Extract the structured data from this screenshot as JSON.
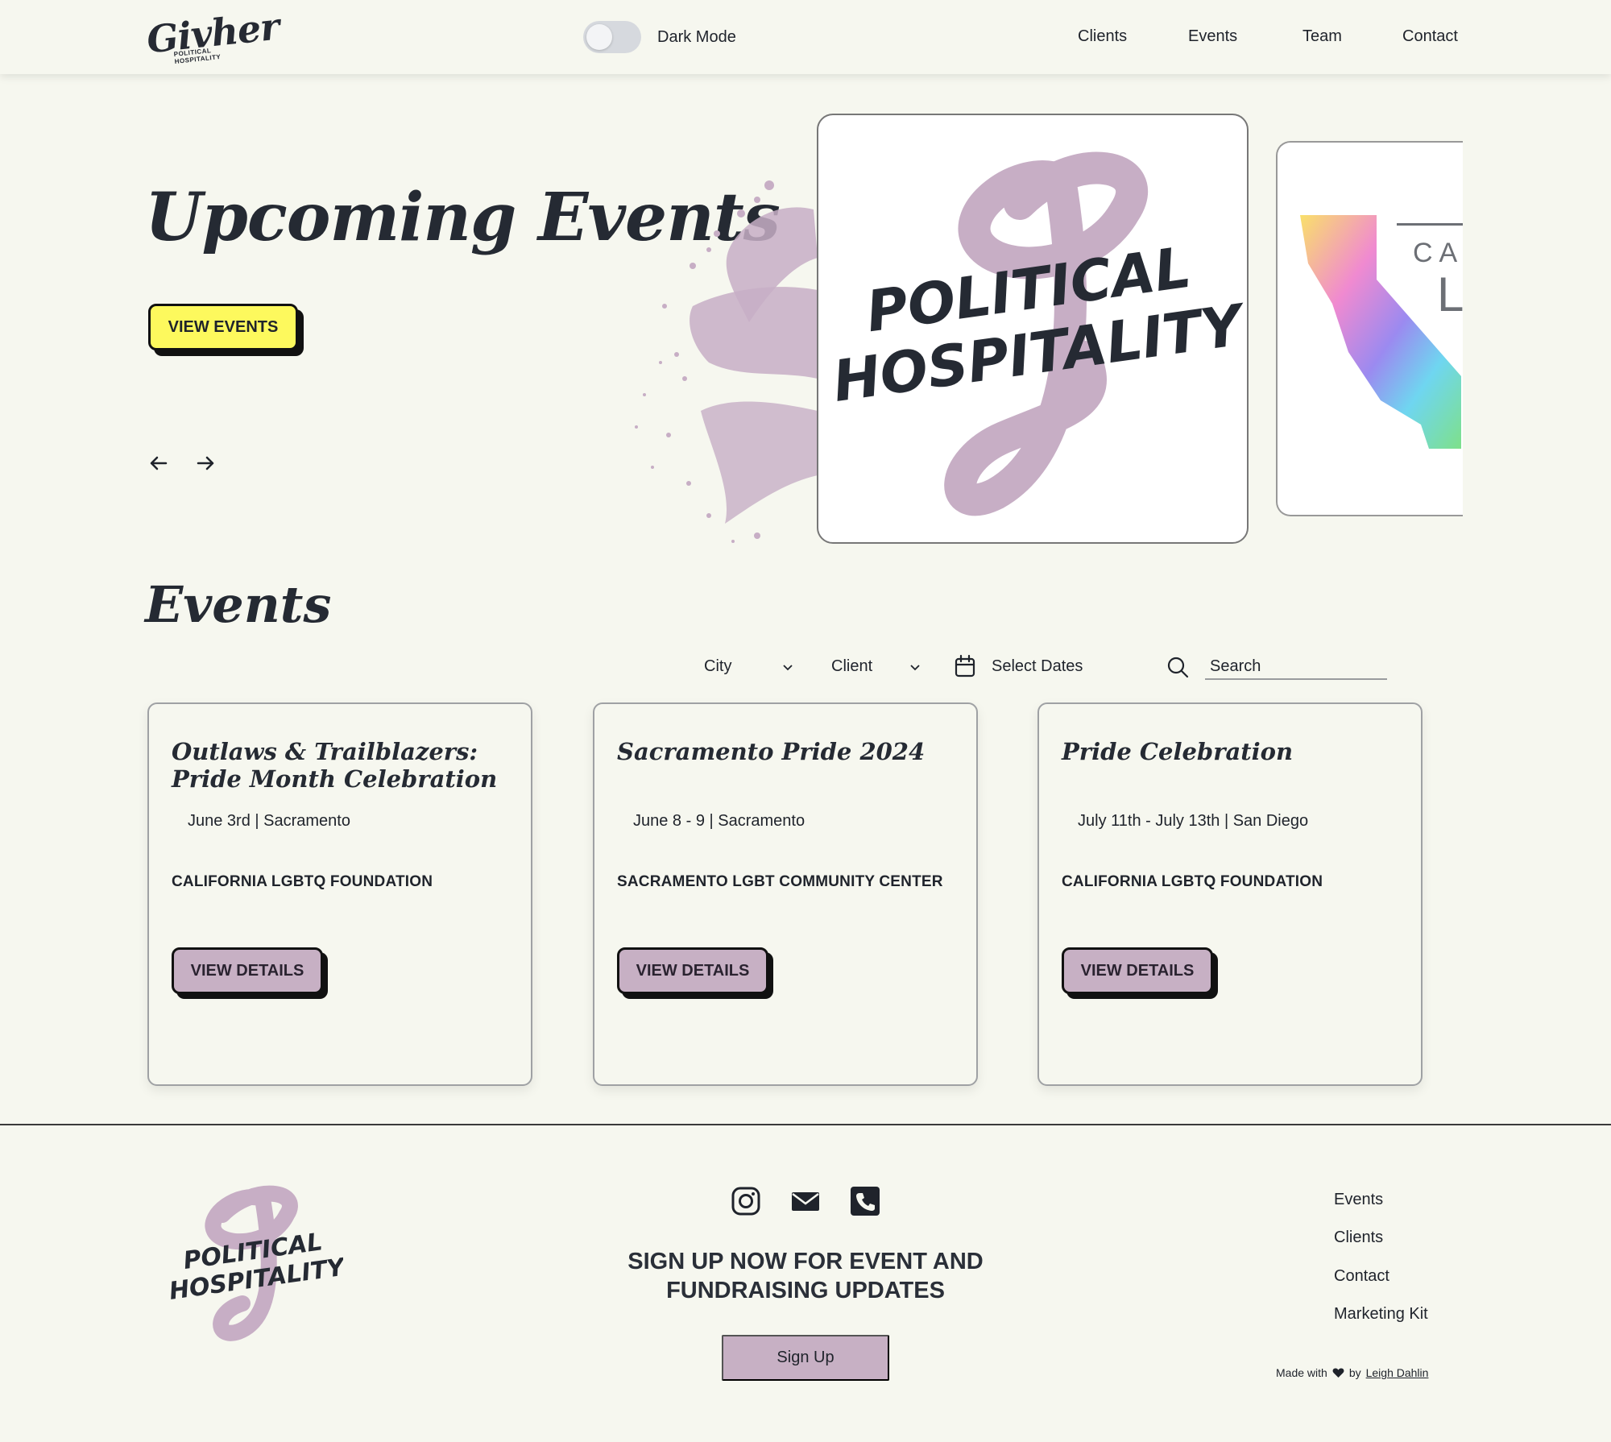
{
  "header": {
    "brand_word": "Givher",
    "brand_sub": "POLITICAL HOSPITALITY",
    "dark_mode_label": "Dark Mode",
    "nav": [
      "Clients",
      "Events",
      "Team",
      "Contact"
    ]
  },
  "hero": {
    "title": "Upcoming Events",
    "cta_label": "VIEW EVENTS",
    "featured_logo_line1": "POLITICAL",
    "featured_logo_line2": "HOSPITALITY",
    "side_card_text_1": "CA",
    "side_card_text_2": "L",
    "icons": [
      "arrow-left-icon",
      "arrow-right-icon"
    ]
  },
  "events": {
    "title": "Events",
    "filters": {
      "city_label": "City",
      "client_label": "Client",
      "dates_label": "Select Dates",
      "search_placeholder": "Search"
    },
    "cards": [
      {
        "title": "Outlaws & Trailblazers: Pride Month Celebration",
        "meta": "June 3rd | Sacramento",
        "org": "CALIFORNIA LGBTQ FOUNDATION",
        "button": "VIEW DETAILS"
      },
      {
        "title": "Sacramento Pride 2024",
        "meta": "June 8 - 9 | Sacramento",
        "org": "SACRAMENTO LGBT COMMUNITY CENTER",
        "button": "VIEW DETAILS"
      },
      {
        "title": "Pride Celebration",
        "meta": "July 11th - July 13th | San Diego",
        "org": "CALIFORNIA LGBTQ FOUNDATION",
        "button": "VIEW DETAILS"
      }
    ]
  },
  "footer": {
    "logo_line1": "POLITICAL",
    "logo_line2": "HOSPITALITY",
    "social_icons": [
      "instagram-icon",
      "mail-icon",
      "phone-icon"
    ],
    "signup_text": "SIGN UP NOW FOR EVENT AND FUNDRAISING UPDATES",
    "signup_button": "Sign Up",
    "links": [
      "Events",
      "Clients",
      "Contact",
      "Marketing Kit"
    ],
    "credit_prefix": "Made with",
    "credit_by": "by",
    "credit_author": "Leigh Dahlin"
  },
  "colors": {
    "background": "#f6f7ef",
    "accent_yellow": "#fdf95d",
    "accent_purple": "#c7b0c4",
    "text": "#1f232b"
  }
}
